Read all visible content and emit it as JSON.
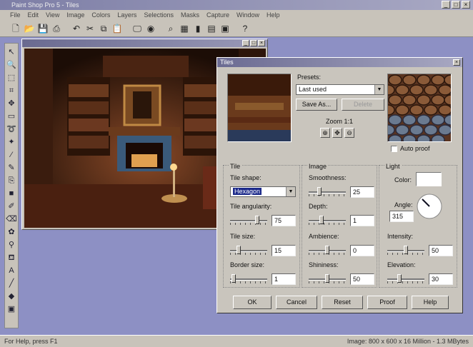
{
  "app": {
    "title": "Paint Shop Pro 5 - Tiles",
    "menu": [
      "File",
      "Edit",
      "View",
      "Image",
      "Colors",
      "Layers",
      "Selections",
      "Masks",
      "Capture",
      "Window",
      "Help"
    ]
  },
  "image_window": {
    "title": "Image1 [1:2] (Background)"
  },
  "status": {
    "left": "For Help, press F1",
    "right": "Image: 800 x 600 x 16 Million - 1.3 MBytes"
  },
  "dialog": {
    "title": "Tiles",
    "close": "×",
    "presets_label": "Presets:",
    "preset_value": "Last used",
    "save_as": "Save As...",
    "delete": "Delete",
    "zoom_label": "Zoom 1:1",
    "auto_proof": "Auto proof",
    "tile": {
      "group": "Tile",
      "shape_label": "Tile shape:",
      "shape_value": "Hexagon",
      "angularity_label": "Tile angularity:",
      "angularity_value": "75",
      "size_label": "Tile size:",
      "size_value": "15",
      "border_label": "Border size:",
      "border_value": "1"
    },
    "image": {
      "group": "Image",
      "smoothness_label": "Smoothness:",
      "smoothness_value": "25",
      "depth_label": "Depth:",
      "depth_value": "1",
      "ambience_label": "Ambience:",
      "ambience_value": "0",
      "shininess_label": "Shininess:",
      "shininess_value": "50"
    },
    "light": {
      "group": "Light",
      "color_label": "Color:",
      "angle_label": "Angle:",
      "angle_value": "315",
      "intensity_label": "Intensity:",
      "intensity_value": "50",
      "elevation_label": "Elevation:",
      "elevation_value": "30"
    },
    "buttons": {
      "ok": "OK",
      "cancel": "Cancel",
      "reset": "Reset",
      "proof": "Proof",
      "help": "Help"
    }
  },
  "slider_levels": {
    "angularity": 0.75,
    "smoothness": 0.25,
    "depth": 0.33,
    "ambience": 0.5,
    "shininess": 0.5,
    "size": 0.2,
    "border": 0.05,
    "intensity": 0.5,
    "elevation": 0.3
  }
}
